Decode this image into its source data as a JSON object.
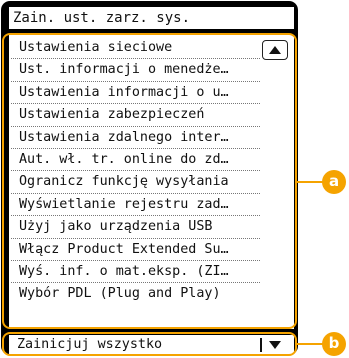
{
  "title": "Zain. ust. zarz. sys.",
  "menu_items": [
    "Ustawienia sieciowe",
    "Ust. informacji o menedże…",
    "Ustawienia informacji o u…",
    "Ustawienia zabezpieczeń",
    "Ustawienia zdalnego inter…",
    "Aut. wł. tr. online do zd…",
    "Ogranicz funkcję wysyłania",
    "Wyświetlanie rejestru zad…",
    "Użyj jako urządzenia USB",
    "Włącz Product Extended Su…",
    "Wyś. inf. o mat.eksp. (ZI…",
    "Wybór PDL (Plug and Play)"
  ],
  "select": {
    "value": "Zainicjuj wszystko"
  },
  "callouts": {
    "a": "a",
    "b": "b"
  },
  "colors": {
    "highlight": "#f5a300",
    "frame": "#000000"
  },
  "icons": {
    "scroll_up": "triangle-up-icon",
    "dropdown": "triangle-down-icon"
  }
}
